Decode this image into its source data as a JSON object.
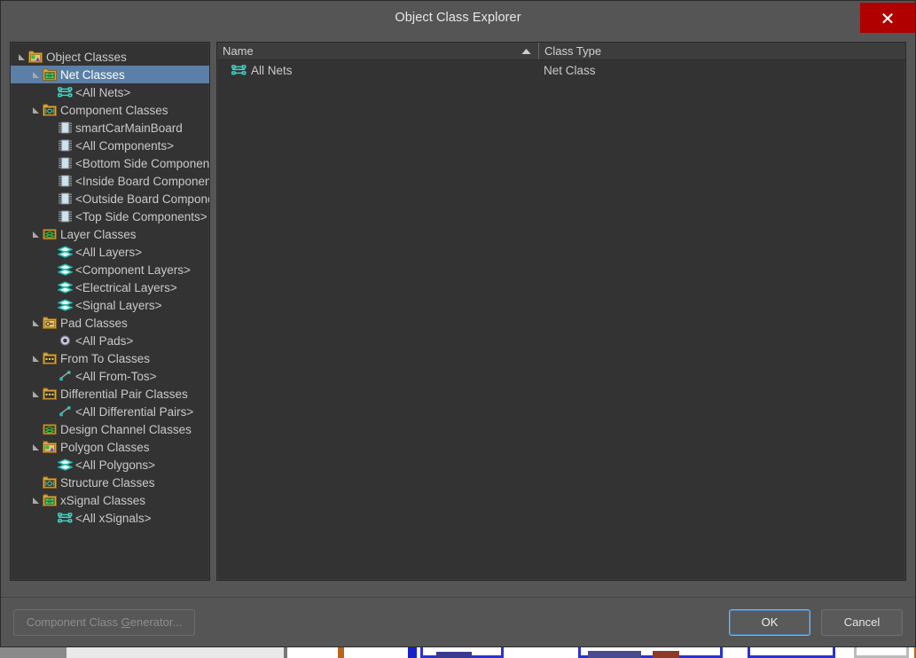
{
  "window": {
    "title": "Object Class Explorer",
    "close_icon": "close-x-icon",
    "accent_close_color": "#b00000",
    "selection_color": "#5b7fa6",
    "panel_bg": "#333333",
    "dialog_bg": "#555555"
  },
  "tree": {
    "root_label": "Object Classes",
    "items": [
      {
        "label": "Object Classes",
        "level": 0,
        "icon": "folder-polygon-icon",
        "expanded": true,
        "selected": false
      },
      {
        "label": "Net Classes",
        "level": 1,
        "icon": "folder-net-icon",
        "expanded": true,
        "selected": true
      },
      {
        "label": "<All Nets>",
        "level": 2,
        "icon": "net-icon",
        "expanded": null,
        "selected": false
      },
      {
        "label": "Component Classes",
        "level": 1,
        "icon": "folder-component-icon",
        "expanded": true,
        "selected": false
      },
      {
        "label": "smartCarMainBoard",
        "level": 2,
        "icon": "component-icon",
        "expanded": null,
        "selected": false
      },
      {
        "label": "<All Components>",
        "level": 2,
        "icon": "component-icon",
        "expanded": null,
        "selected": false
      },
      {
        "label": "<Bottom Side Components>",
        "level": 2,
        "icon": "component-icon",
        "expanded": null,
        "selected": false
      },
      {
        "label": "<Inside Board Components>",
        "level": 2,
        "icon": "component-icon",
        "expanded": null,
        "selected": false
      },
      {
        "label": "<Outside Board Components>",
        "level": 2,
        "icon": "component-icon",
        "expanded": null,
        "selected": false
      },
      {
        "label": "<Top Side Components>",
        "level": 2,
        "icon": "component-icon",
        "expanded": null,
        "selected": false
      },
      {
        "label": "Layer Classes",
        "level": 1,
        "icon": "folder-layer-icon",
        "expanded": true,
        "selected": false
      },
      {
        "label": "<All Layers>",
        "level": 2,
        "icon": "layer-icon",
        "expanded": null,
        "selected": false
      },
      {
        "label": "<Component Layers>",
        "level": 2,
        "icon": "layer-icon",
        "expanded": null,
        "selected": false
      },
      {
        "label": "<Electrical Layers>",
        "level": 2,
        "icon": "layer-icon",
        "expanded": null,
        "selected": false
      },
      {
        "label": "<Signal Layers>",
        "level": 2,
        "icon": "layer-icon",
        "expanded": null,
        "selected": false
      },
      {
        "label": "Pad Classes",
        "level": 1,
        "icon": "folder-pad-icon",
        "expanded": true,
        "selected": false
      },
      {
        "label": "<All Pads>",
        "level": 2,
        "icon": "pad-icon",
        "expanded": null,
        "selected": false
      },
      {
        "label": "From To Classes",
        "level": 1,
        "icon": "folder-fromto-icon",
        "expanded": true,
        "selected": false
      },
      {
        "label": "<All From-Tos>",
        "level": 2,
        "icon": "fromto-icon",
        "expanded": null,
        "selected": false
      },
      {
        "label": "Differential Pair Classes",
        "level": 1,
        "icon": "folder-fromto-icon",
        "expanded": true,
        "selected": false
      },
      {
        "label": "<All Differential Pairs>",
        "level": 2,
        "icon": "fromto-icon",
        "expanded": null,
        "selected": false
      },
      {
        "label": "Design Channel Classes",
        "level": 1,
        "icon": "folder-layer-icon",
        "expanded": false,
        "selected": false
      },
      {
        "label": "Polygon Classes",
        "level": 1,
        "icon": "folder-polygon-icon",
        "expanded": true,
        "selected": false
      },
      {
        "label": "<All Polygons>",
        "level": 2,
        "icon": "layer-icon",
        "expanded": null,
        "selected": false
      },
      {
        "label": "Structure Classes",
        "level": 1,
        "icon": "folder-component-icon",
        "expanded": false,
        "selected": false
      },
      {
        "label": "xSignal Classes",
        "level": 1,
        "icon": "folder-net-icon",
        "expanded": true,
        "selected": false
      },
      {
        "label": "<All xSignals>",
        "level": 2,
        "icon": "net-icon",
        "expanded": null,
        "selected": false
      }
    ]
  },
  "list": {
    "columns": [
      {
        "label": "Name",
        "sorted": "asc"
      },
      {
        "label": "Class Type",
        "sorted": null
      }
    ],
    "rows": [
      {
        "icon": "net-icon",
        "name": "All Nets",
        "class_type": "Net Class"
      }
    ]
  },
  "footer": {
    "generator_label": "Component Class Generator...",
    "generator_mnemonic": "G",
    "generator_enabled": false,
    "ok_label": "OK",
    "cancel_label": "Cancel"
  }
}
